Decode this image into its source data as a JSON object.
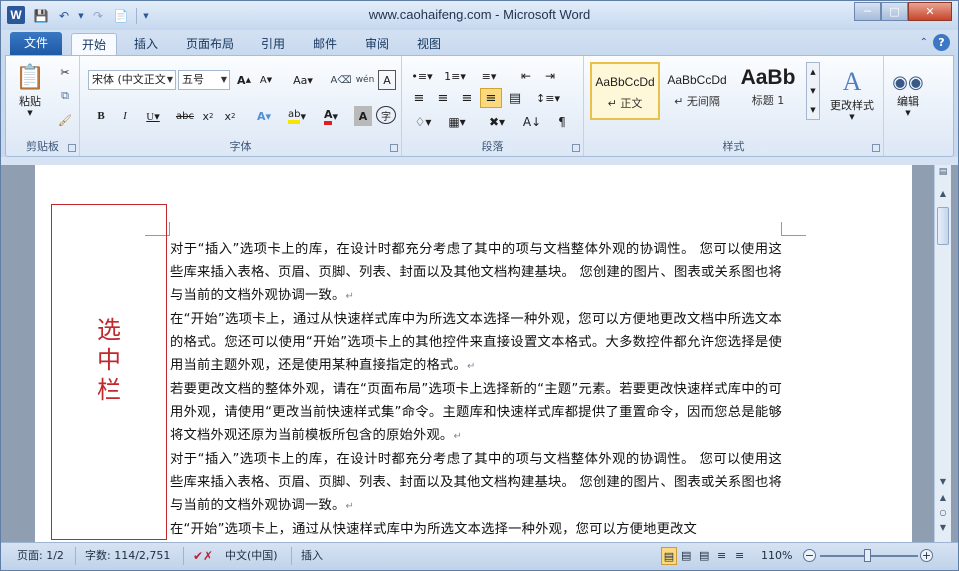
{
  "window": {
    "title": "www.caohaifeng.com - Microsoft Word",
    "controls": [
      "minimize",
      "maximize",
      "close"
    ]
  },
  "tabs": {
    "file": "文件",
    "items": [
      "开始",
      "插入",
      "页面布局",
      "引用",
      "邮件",
      "审阅",
      "视图"
    ],
    "active": "开始"
  },
  "ribbon": {
    "clipboard": {
      "label": "剪贴板",
      "paste": "粘贴"
    },
    "font": {
      "label": "字体",
      "font_name": "宋体 (中文正文",
      "font_size": "五号"
    },
    "paragraph": {
      "label": "段落"
    },
    "styles": {
      "label": "样式",
      "items": [
        {
          "sample": "AaBbCcDd",
          "name": "↵ 正文",
          "selected": true
        },
        {
          "sample": "AaBbCcDd",
          "name": "↵ 无间隔",
          "selected": false
        },
        {
          "sample": "AaBb",
          "name": "标题 1",
          "selected": false
        }
      ],
      "change_styles": "更改样式"
    },
    "editing": {
      "label": "编辑"
    }
  },
  "document": {
    "selection_bar_label": [
      "选",
      "中",
      "栏"
    ],
    "paragraphs": [
      "对于“插入”选项卡上的库，在设计时都充分考虑了其中的项与文档整体外观的协调性。 您可以使用这些库来插入表格、页眉、页脚、列表、封面以及其他文档构建基块。 您创建的图片、图表或关系图也将与当前的文档外观协调一致。",
      "在“开始”选项卡上，通过从快速样式库中为所选文本选择一种外观，您可以方便地更改文档中所选文本的格式。您还可以使用“开始”选项卡上的其他控件来直接设置文本格式。大多数控件都允许您选择是使用当前主题外观，还是使用某种直接指定的格式。",
      "若要更改文档的整体外观，请在“页面布局”选项卡上选择新的“主题”元素。若要更改快速样式库中的可用外观，请使用“更改当前快速样式集”命令。主题库和快速样式库都提供了重置命令，因而您总是能够将文档外观还原为当前模板所包含的原始外观。",
      "对于“插入”选项卡上的库，在设计时都充分考虑了其中的项与文档整体外观的协调性。 您可以使用这些库来插入表格、页眉、页脚、列表、封面以及其他文档构建基块。 您创建的图片、图表或关系图也将与当前的文档外观协调一致。",
      "在“开始”选项卡上，通过从快速样式库中为所选文本选择一种外观，您可以方便地更改文"
    ]
  },
  "status": {
    "page": "页面: 1/2",
    "words": "字数: 114/2,751",
    "language": "中文(中国)",
    "mode": "插入",
    "zoom": "110%",
    "zoom_minus": "−",
    "zoom_plus": "+"
  },
  "colors": {
    "accent": "#2b579a",
    "selection_bar": "#c0282d"
  },
  "icons": [
    "word-logo-icon",
    "save-icon",
    "undo-icon",
    "redo-icon",
    "new-doc-icon",
    "help-icon"
  ]
}
